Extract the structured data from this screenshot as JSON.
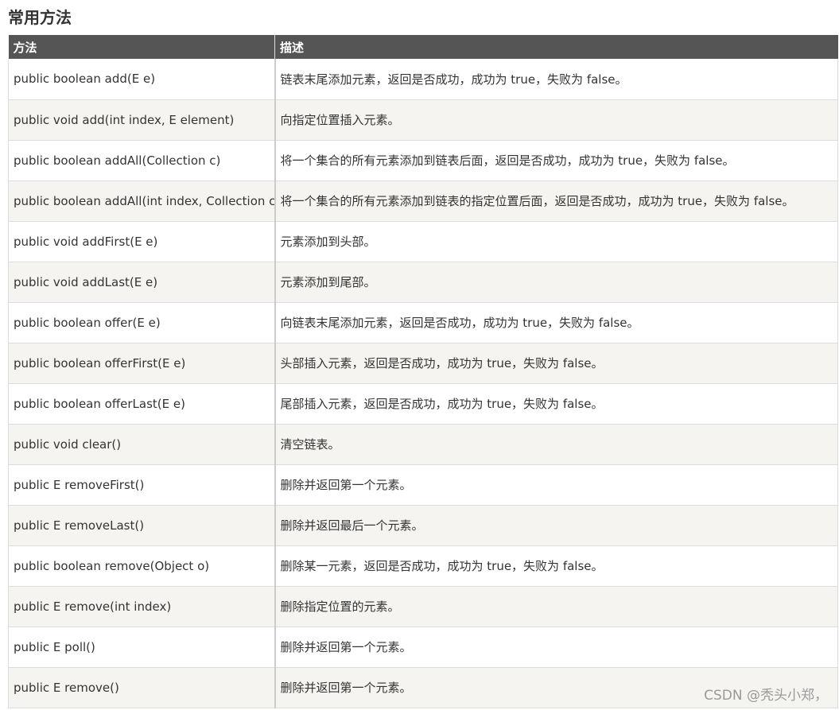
{
  "title": "常用方法",
  "table": {
    "headers": [
      "方法",
      "描述"
    ],
    "rows": [
      {
        "method": "public boolean add(E e)",
        "description": "链表末尾添加元素，返回是否成功，成功为 true，失败为 false。"
      },
      {
        "method": "public void add(int index, E element)",
        "description": "向指定位置插入元素。"
      },
      {
        "method": "public boolean addAll(Collection c)",
        "description": "将一个集合的所有元素添加到链表后面，返回是否成功，成功为 true，失败为 false。"
      },
      {
        "method": "public boolean addAll(int index, Collection c)",
        "description": "将一个集合的所有元素添加到链表的指定位置后面，返回是否成功，成功为 true，失败为 false。"
      },
      {
        "method": "public void addFirst(E e)",
        "description": "元素添加到头部。"
      },
      {
        "method": "public void addLast(E e)",
        "description": "元素添加到尾部。"
      },
      {
        "method": "public boolean offer(E e)",
        "description": "向链表末尾添加元素，返回是否成功，成功为 true，失败为 false。"
      },
      {
        "method": "public boolean offerFirst(E e)",
        "description": "头部插入元素，返回是否成功，成功为 true，失败为 false。"
      },
      {
        "method": "public boolean offerLast(E e)",
        "description": "尾部插入元素，返回是否成功，成功为 true，失败为 false。"
      },
      {
        "method": "public void clear()",
        "description": "清空链表。"
      },
      {
        "method": "public E removeFirst()",
        "description": "删除并返回第一个元素。"
      },
      {
        "method": "public E removeLast()",
        "description": "删除并返回最后一个元素。"
      },
      {
        "method": "public boolean remove(Object o)",
        "description": "删除某一元素，返回是否成功，成功为 true，失败为 false。"
      },
      {
        "method": "public E remove(int index)",
        "description": "删除指定位置的元素。"
      },
      {
        "method": "public E poll()",
        "description": "删除并返回第一个元素。"
      },
      {
        "method": "public E remove()",
        "description": "删除并返回第一个元素。"
      }
    ]
  },
  "watermark": "CSDN @秃头小郑，"
}
